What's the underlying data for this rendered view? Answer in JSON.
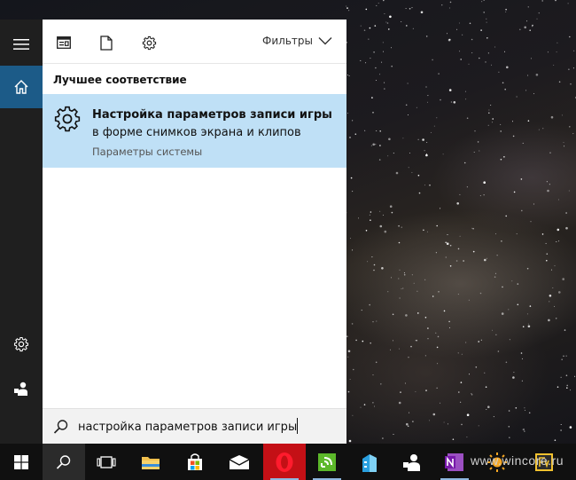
{
  "panel": {
    "filters_label": "Фильтры",
    "section_title": "Лучшее соответствие",
    "best_match": {
      "title_bold": "Настройка параметров записи игры",
      "title_rest": " в форме снимков экрана и клипов",
      "subtitle": "Параметры системы",
      "icon": "gear-icon"
    },
    "search": {
      "value": "настройка параметров записи игры"
    }
  },
  "rail": {
    "items": [
      "hamburger-icon",
      "home-icon",
      "settings-icon",
      "user-icon"
    ],
    "active_color": "#1c5b88"
  },
  "taskbar": {
    "apps": [
      "start",
      "search",
      "task-view",
      "file-explorer",
      "store",
      "mail",
      "opera",
      "greenshot",
      "azure",
      "people",
      "onenote",
      "fotor",
      "foxit"
    ],
    "watermark": "www.wincore.ru"
  },
  "colors": {
    "highlight": "#bfe0f6",
    "rail": "#1f1f1f",
    "taskbar": "#101010",
    "opera": "#cc0f16"
  }
}
